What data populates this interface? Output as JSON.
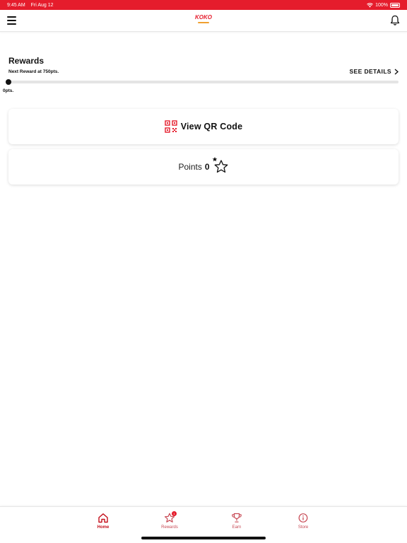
{
  "status_bar": {
    "time": "9:45 AM",
    "date": "Fri Aug 12",
    "battery": "100%"
  },
  "header": {
    "logo_text": "KOKO"
  },
  "rewards": {
    "title": "Rewards",
    "next_reward": "Next Reward at 750pts.",
    "see_details_label": "SEE DETAILS",
    "progress_label": "0pts.",
    "progress_fraction": 0
  },
  "qr_card": {
    "label": "View QR Code"
  },
  "points_card": {
    "label": "Points",
    "value": "0"
  },
  "tabs": [
    {
      "label": "Home",
      "icon": "home-icon",
      "active": true
    },
    {
      "label": "Rewards",
      "icon": "star-icon",
      "active": false,
      "badge": "1"
    },
    {
      "label": "Earn",
      "icon": "trophy-icon",
      "active": false
    },
    {
      "label": "Store",
      "icon": "info-icon",
      "active": false
    }
  ],
  "colors": {
    "brand_red": "#e51c2c",
    "tab_active": "#c4101c",
    "tab_inactive": "#c84a55",
    "text": "#111111"
  }
}
